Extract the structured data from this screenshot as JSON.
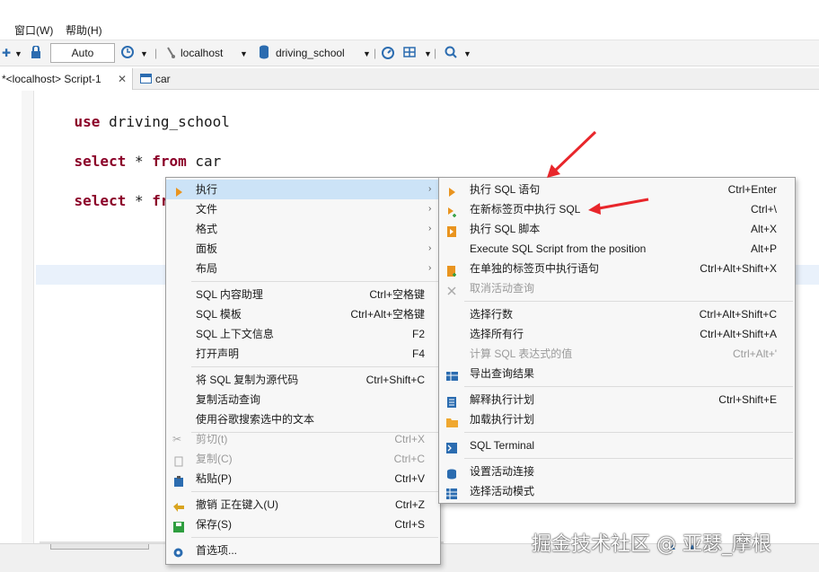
{
  "menubar": {
    "window": "窗口(W)",
    "help": "帮助(H)"
  },
  "toolbar": {
    "commit_mode": "Auto",
    "connection": "localhost",
    "database": "driving_school"
  },
  "tabs": [
    {
      "label": "*<localhost> Script-1"
    },
    {
      "label": "car"
    }
  ],
  "editor": {
    "line1_kw": "use",
    "line1_rest": " driving_school",
    "line2_kw1": "select",
    "line2_mid": " * ",
    "line2_kw2": "from",
    "line2_rest": " car",
    "line3_kw1": "select",
    "line3_mid": " * ",
    "line3_kw2": "from"
  },
  "context_menu": {
    "items": [
      {
        "label": "执行",
        "shortcut": ""
      },
      {
        "label": "文件",
        "shortcut": ""
      },
      {
        "label": "格式",
        "shortcut": ""
      },
      {
        "label": "面板",
        "shortcut": ""
      },
      {
        "label": "布局",
        "shortcut": ""
      },
      {
        "label": "SQL 内容助理",
        "shortcut": "Ctrl+空格键"
      },
      {
        "label": "SQL 模板",
        "shortcut": "Ctrl+Alt+空格键"
      },
      {
        "label": "SQL 上下文信息",
        "shortcut": "F2"
      },
      {
        "label": "打开声明",
        "shortcut": "F4"
      },
      {
        "label": "将 SQL 复制为源代码",
        "shortcut": "Ctrl+Shift+C"
      },
      {
        "label": "复制活动查询",
        "shortcut": ""
      },
      {
        "label": "使用谷歌搜索选中的文本",
        "shortcut": ""
      },
      {
        "label": "剪切(t)",
        "shortcut": "Ctrl+X"
      },
      {
        "label": "复制(C)",
        "shortcut": "Ctrl+C"
      },
      {
        "label": "粘贴(P)",
        "shortcut": "Ctrl+V"
      },
      {
        "label": "撤销 正在键入(U)",
        "shortcut": "Ctrl+Z"
      },
      {
        "label": "保存(S)",
        "shortcut": "Ctrl+S"
      },
      {
        "label": "首选项...",
        "shortcut": ""
      }
    ]
  },
  "submenu": {
    "items": [
      {
        "label": "执行 SQL 语句",
        "shortcut": "Ctrl+Enter"
      },
      {
        "label": "在新标签页中执行 SQL",
        "shortcut": "Ctrl+\\"
      },
      {
        "label": "执行 SQL 脚本",
        "shortcut": "Alt+X"
      },
      {
        "label": "Execute SQL Script from the position",
        "shortcut": "Alt+P"
      },
      {
        "label": "在单独的标签页中执行语句",
        "shortcut": "Ctrl+Alt+Shift+X"
      },
      {
        "label": "取消活动查询",
        "shortcut": ""
      },
      {
        "label": "选择行数",
        "shortcut": "Ctrl+Alt+Shift+C"
      },
      {
        "label": "选择所有行",
        "shortcut": "Ctrl+Alt+Shift+A"
      },
      {
        "label": "计算 SQL 表达式的值",
        "shortcut": "Ctrl+Alt+'"
      },
      {
        "label": "导出查询结果",
        "shortcut": ""
      },
      {
        "label": "解释执行计划",
        "shortcut": "Ctrl+Shift+E"
      },
      {
        "label": "加载执行计划",
        "shortcut": ""
      },
      {
        "label": "SQL Terminal",
        "shortcut": ""
      },
      {
        "label": "设置活动连接",
        "shortcut": ""
      },
      {
        "label": "选择活动模式",
        "shortcut": ""
      }
    ]
  },
  "watermark": "掘金技术社区 @ 亚瑟_摩根",
  "colors": {
    "keyword": "#8b0028",
    "highlight": "#cce3f7",
    "arrow": "#e8262b"
  }
}
